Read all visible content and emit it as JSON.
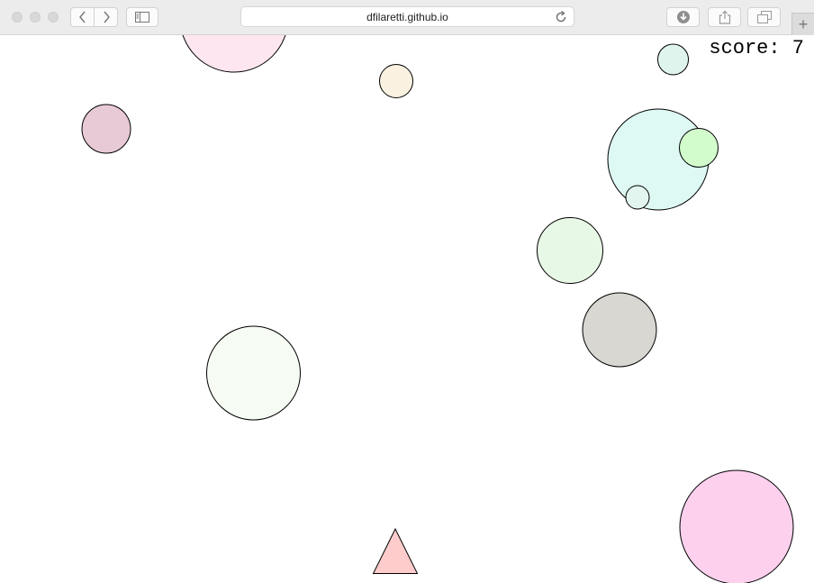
{
  "browser": {
    "url": "dfilaretti.github.io",
    "icons": {
      "back": "chevron-left-icon",
      "forward": "chevron-right-icon",
      "sidebar": "sidebar-icon",
      "reload": "reload-icon",
      "download": "download-icon",
      "share": "share-icon",
      "tabs": "tabs-icon",
      "new_tab": "plus-icon"
    },
    "new_tab_glyph": "+"
  },
  "game": {
    "score_label": "score:",
    "score_value": 7,
    "score_text": "score: 7",
    "colors": {
      "player": "#ffcccc",
      "outline": "#000000"
    },
    "circles": [
      {
        "name": "pink-ball-top",
        "color": "#fde6ef"
      },
      {
        "name": "cream-ball",
        "color": "#faf1e0"
      },
      {
        "name": "teal-ball-small",
        "color": "#e0f4ee"
      },
      {
        "name": "mauve-ball",
        "color": "#e8cad6"
      },
      {
        "name": "aqua-ball-large",
        "color": "#def9f4"
      },
      {
        "name": "green-ball-small",
        "color": "#d3fccc"
      },
      {
        "name": "tiny-ball",
        "color": "#e2f5ee"
      },
      {
        "name": "mint-ball",
        "color": "#e8f8e6"
      },
      {
        "name": "grey-ball",
        "color": "#d8d7d2"
      },
      {
        "name": "pale-green-ball",
        "color": "#f6fcf3"
      },
      {
        "name": "pink-ball-large",
        "color": "#fdd0ee"
      }
    ]
  }
}
